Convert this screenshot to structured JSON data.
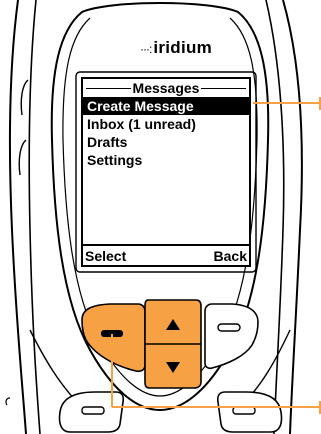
{
  "brand": {
    "dots": "···:",
    "name": "iridium"
  },
  "screen": {
    "title": "Messages",
    "menu": [
      {
        "label": "Create Message",
        "selected": true
      },
      {
        "label": "Inbox (1 unread)",
        "selected": false
      },
      {
        "label": "Drafts",
        "selected": false
      },
      {
        "label": "Settings",
        "selected": false
      }
    ],
    "softkeys": {
      "left": "Select",
      "right": "Back"
    }
  },
  "keys": {
    "left_softkey_icon": "minus-icon",
    "right_softkey_icon": "rounded-bar-icon",
    "nav_up_icon": "triangle-up-icon",
    "nav_down_icon": "triangle-down-icon"
  },
  "colors": {
    "highlight_key": "#f7a145",
    "callout_line": "#f7a145",
    "screen_selection": "#000000"
  }
}
